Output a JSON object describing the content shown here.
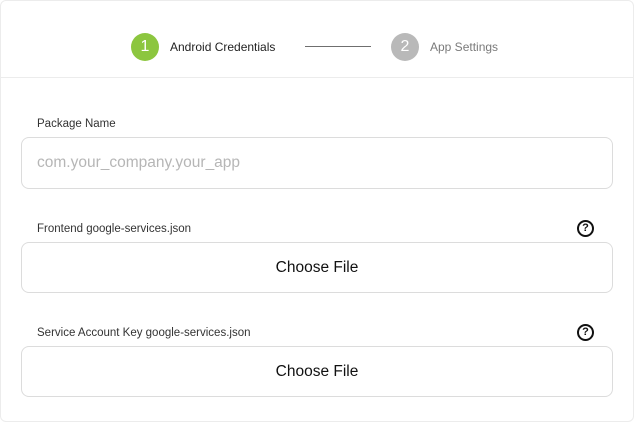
{
  "colors": {
    "step_active": "#8cc63f",
    "step_inactive": "#b9b9b9",
    "step_active_text": "#1f1f1f",
    "step_inactive_text": "#7a7a7a"
  },
  "stepper": {
    "steps": [
      {
        "number": "1",
        "label": "Android Credentials",
        "state": "active"
      },
      {
        "number": "2",
        "label": "App Settings",
        "state": "inactive"
      }
    ]
  },
  "form": {
    "package_name": {
      "label": "Package Name",
      "value": "",
      "placeholder": "com.your_company.your_app"
    },
    "frontend_file": {
      "label": "Frontend google-services.json",
      "help_icon": "question-circle-icon",
      "help_glyph": "?",
      "button_label": "Choose File"
    },
    "service_account_file": {
      "label": "Service Account Key google-services.json",
      "help_icon": "question-circle-icon",
      "help_glyph": "?",
      "button_label": "Choose File"
    }
  }
}
